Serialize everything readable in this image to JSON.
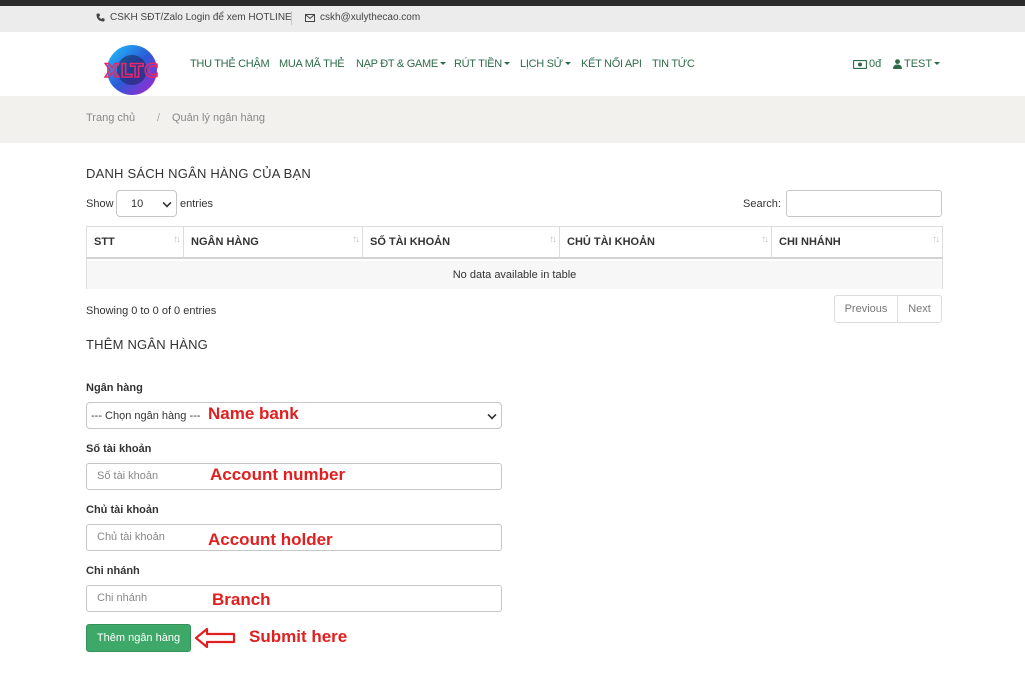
{
  "topbar": {
    "hotline": "CSKH SĐT/Zalo Login để xem HOTLINE",
    "email": "cskh@xulythecao.com"
  },
  "brand": {
    "logo_text": "XLTC"
  },
  "nav": {
    "items": [
      {
        "label": "THU THẺ CHẬM",
        "dropdown": false
      },
      {
        "label": "MUA MÃ THẺ",
        "dropdown": false
      },
      {
        "label": "NẠP ĐT & GAME",
        "dropdown": true
      },
      {
        "label": "RÚT TIỀN",
        "dropdown": true
      },
      {
        "label": "LỊCH SỬ",
        "dropdown": true
      },
      {
        "label": "KẾT NỐI API",
        "dropdown": false
      },
      {
        "label": "TIN TỨC",
        "dropdown": false
      }
    ],
    "balance": "0đ",
    "user": "TEST"
  },
  "breadcrumb": {
    "home": "Trang chủ",
    "separator": "/",
    "current": "Quản lý ngân hàng"
  },
  "bank_list": {
    "title": "DANH SÁCH NGÂN HÀNG CỦA BẠN",
    "show_label": "Show",
    "entries_value": "10",
    "entries_label": "entries",
    "search_label": "Search:",
    "columns": [
      "STT",
      "NGÂN HÀNG",
      "SỐ TÀI KHOẢN",
      "CHỦ TÀI KHOẢN",
      "CHI NHÁNH"
    ],
    "empty_text": "No data available in table",
    "info": "Showing 0 to 0 of 0 entries",
    "prev_label": "Previous",
    "next_label": "Next"
  },
  "add_form": {
    "title": "THÊM NGÂN HÀNG",
    "bank_label": "Ngân hàng",
    "bank_select_value": "--- Chọn ngân hàng ---",
    "account_number_label": "Số tài khoản",
    "account_number_placeholder": "Số tài khoản",
    "account_holder_label": "Chủ tài khoản",
    "account_holder_placeholder": "Chủ tài khoản",
    "branch_label": "Chi nhánh",
    "branch_placeholder": "Chi nhánh",
    "submit_label": "Thêm ngân hàng"
  },
  "annotations": {
    "name_bank": "Name bank",
    "account_number": "Account number",
    "account_holder": "Account holder",
    "branch": "Branch",
    "submit": "Submit here"
  },
  "colors": {
    "nav_green": "#2e6b4a",
    "button_green": "#3ea869",
    "annotation_red": "#e02020"
  }
}
